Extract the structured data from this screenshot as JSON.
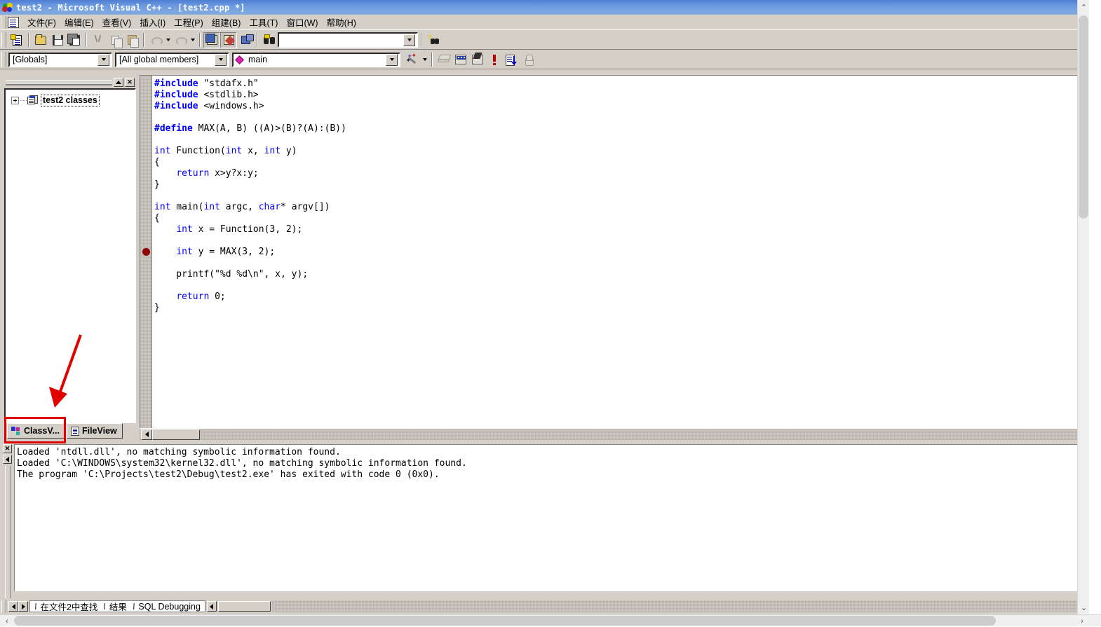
{
  "window": {
    "title": "test2 - Microsoft Visual C++ - [test2.cpp *]",
    "icon": "vcpp-logo-icon"
  },
  "menubar": {
    "doc_icon": "document-icon",
    "items": [
      {
        "label": "文件(F)",
        "name": "menu-file"
      },
      {
        "label": "编辑(E)",
        "name": "menu-edit"
      },
      {
        "label": "查看(V)",
        "name": "menu-view"
      },
      {
        "label": "插入(I)",
        "name": "menu-insert"
      },
      {
        "label": "工程(P)",
        "name": "menu-project"
      },
      {
        "label": "组建(B)",
        "name": "menu-build"
      },
      {
        "label": "工具(T)",
        "name": "menu-tools"
      },
      {
        "label": "窗口(W)",
        "name": "menu-window"
      },
      {
        "label": "帮助(H)",
        "name": "menu-help"
      }
    ]
  },
  "standard_toolbar": {
    "buttons": [
      "new-document-icon",
      "open-folder-icon",
      "save-icon",
      "save-all-icon",
      "cut-icon",
      "copy-icon",
      "paste-icon",
      "undo-icon",
      "redo-icon",
      "workspace-window-icon",
      "output-window-icon",
      "window-list-icon",
      "find-in-files-icon",
      "search-help-icon"
    ],
    "find_combo": {
      "value": "",
      "placeholder": ""
    }
  },
  "wizardbar": {
    "scope_combo": {
      "value": "[Globals]"
    },
    "members_combo": {
      "value": "[All global members]"
    },
    "function_combo": {
      "value": "main",
      "icon": "member-diamond-icon"
    },
    "actions_icon": "wizard-wand-icon",
    "buttons": [
      "compile-icon",
      "build-icon",
      "build-execute-icon",
      "stop-build-icon",
      "go-icon",
      "insert-breakpoint-icon"
    ]
  },
  "workspace": {
    "caption_buttons": [
      "dock-pin-icon",
      "close-icon"
    ],
    "tree": {
      "expander": "plus-expander-icon",
      "icon": "class-folder-icon",
      "label": "test2 classes"
    },
    "tabs": [
      {
        "label": "ClassV...",
        "icon": "class-view-icon",
        "active": true,
        "name": "tab-classview"
      },
      {
        "label": "FileView",
        "icon": "file-view-icon",
        "active": false,
        "name": "tab-fileview"
      }
    ]
  },
  "editor": {
    "breakpoint_line": 16,
    "lines": [
      [
        {
          "t": "#include",
          "c": "pp"
        },
        {
          "t": " \"stdafx.h\"",
          "c": ""
        }
      ],
      [
        {
          "t": "#include",
          "c": "pp"
        },
        {
          "t": " <stdlib.h>",
          "c": ""
        }
      ],
      [
        {
          "t": "#include",
          "c": "pp"
        },
        {
          "t": " <windows.h>",
          "c": ""
        }
      ],
      [],
      [
        {
          "t": "#define",
          "c": "pp"
        },
        {
          "t": " MAX(A, B) ((A)>(B)?(A):(B))",
          "c": ""
        }
      ],
      [],
      [
        {
          "t": "int",
          "c": "kw"
        },
        {
          "t": " Function(",
          "c": ""
        },
        {
          "t": "int",
          "c": "kw"
        },
        {
          "t": " x, ",
          "c": ""
        },
        {
          "t": "int",
          "c": "kw"
        },
        {
          "t": " y)",
          "c": ""
        }
      ],
      [
        {
          "t": "{",
          "c": ""
        }
      ],
      [
        {
          "t": "    ",
          "c": ""
        },
        {
          "t": "return",
          "c": "kw"
        },
        {
          "t": " x>y?x:y;",
          "c": ""
        }
      ],
      [
        {
          "t": "}",
          "c": ""
        }
      ],
      [],
      [
        {
          "t": "int",
          "c": "kw"
        },
        {
          "t": " main(",
          "c": ""
        },
        {
          "t": "int",
          "c": "kw"
        },
        {
          "t": " argc, ",
          "c": ""
        },
        {
          "t": "char",
          "c": "kw"
        },
        {
          "t": "* argv[])",
          "c": ""
        }
      ],
      [
        {
          "t": "{",
          "c": ""
        }
      ],
      [
        {
          "t": "    ",
          "c": ""
        },
        {
          "t": "int",
          "c": "kw"
        },
        {
          "t": " x = Function(3, 2);",
          "c": ""
        }
      ],
      [],
      [
        {
          "t": "    ",
          "c": ""
        },
        {
          "t": "int",
          "c": "kw"
        },
        {
          "t": " y = MAX(3, 2);",
          "c": ""
        }
      ],
      [],
      [
        {
          "t": "    printf(\"%d %d\\n\", x, y);",
          "c": ""
        }
      ],
      [],
      [
        {
          "t": "    ",
          "c": ""
        },
        {
          "t": "return",
          "c": "kw"
        },
        {
          "t": " 0;",
          "c": ""
        }
      ],
      [
        {
          "t": "}",
          "c": ""
        }
      ]
    ]
  },
  "output": {
    "close_icon": "close-icon",
    "scroll_icon": "scroll-left-icon",
    "lines": [
      "Loaded 'ntdll.dll', no matching symbolic information found.",
      "Loaded 'C:\\WINDOWS\\system32\\kernel32.dll', no matching symbolic information found.",
      "The program 'C:\\Projects\\test2\\Debug\\test2.exe' has exited with code 0 (0x0)."
    ]
  },
  "bottom_tabs": {
    "nav_prev_icon": "scroll-left-icon",
    "nav_next_icon": "scroll-right-icon",
    "tabs": [
      {
        "label": "在文件2中查找",
        "name": "tab-find-in-files-2"
      },
      {
        "label": "结果",
        "name": "tab-results"
      },
      {
        "label": "SQL Debugging",
        "name": "tab-sql-debugging"
      }
    ],
    "after_nav_icon": "scroll-left-icon"
  },
  "annotations": {
    "highlight_color": "#e00000",
    "rect_target": "ClassV... tab",
    "arrow_target": "ClassV... tab"
  },
  "page_scroll": {
    "up_icon": "chevron-up-icon",
    "down_icon": "chevron-down-icon",
    "left_icon": "chevron-left-icon",
    "right_icon": "chevron-right-icon"
  }
}
